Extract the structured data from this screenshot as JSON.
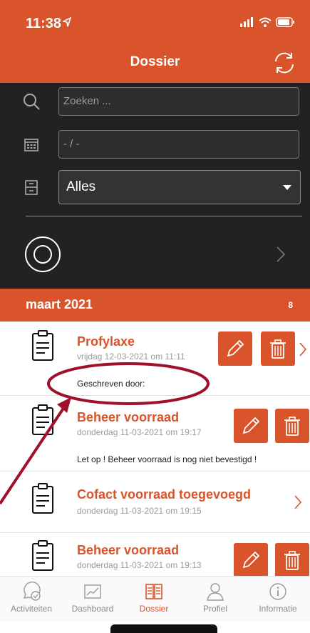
{
  "status_bar": {
    "time": "11:38"
  },
  "header": {
    "title": "Dossier"
  },
  "filters": {
    "search_placeholder": "Zoeken ...",
    "date_value": "- / -",
    "category_selected": "Alles"
  },
  "section": {
    "title": "maart 2021",
    "count": "8"
  },
  "entries": [
    {
      "title": "Profylaxe",
      "date": "vrijdag 12-03-2021 om 11:11",
      "note": "Geschreven door:"
    },
    {
      "title": "Beheer voorraad",
      "date": "donderdag 11-03-2021 om 19:17",
      "note": "Let op ! Beheer voorraad is nog niet bevestigd !"
    },
    {
      "title": "Cofact voorraad toegevoegd",
      "date": "donderdag 11-03-2021 om 19:15",
      "note": ""
    },
    {
      "title": "Beheer voorraad",
      "date": "donderdag 11-03-2021 om 19:13",
      "note": ""
    }
  ],
  "tabs": [
    {
      "label": "Activiteiten",
      "icon": "activity-chat-icon"
    },
    {
      "label": "Dashboard",
      "icon": "chart-icon"
    },
    {
      "label": "Dossier",
      "icon": "book-icon",
      "active": true
    },
    {
      "label": "Profiel",
      "icon": "person-icon"
    },
    {
      "label": "Informatie",
      "icon": "info-icon"
    }
  ],
  "colors": {
    "accent": "#d9542b",
    "panel": "#222222",
    "annotation": "#a0102a"
  }
}
